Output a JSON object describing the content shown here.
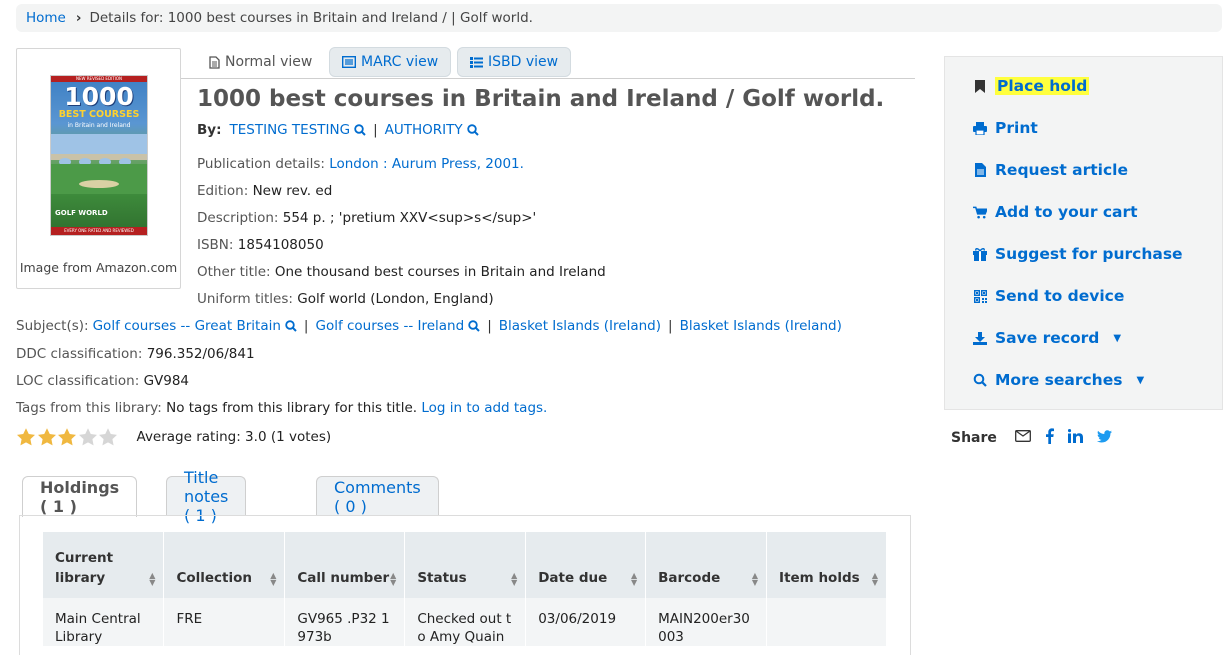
{
  "breadcrumb": {
    "home": "Home",
    "current": "Details for: 1000 best courses in Britain and Ireland / | Golf world."
  },
  "cover": {
    "caption": "Image from Amazon.com",
    "band_text": "NEW REVISED EDITION",
    "big_text": "1000",
    "best_text": "BEST COURSES",
    "sub_text": "in Britain and Ireland",
    "logo_text": "GOLF WORLD",
    "foot_text": "EVERY ONE RATED AND REVIEWED"
  },
  "view_tabs": {
    "normal": "Normal view",
    "marc": "MARC view",
    "isbd": "ISBD view"
  },
  "record": {
    "title": "1000 best courses in Britain and Ireland / Golf world.",
    "by_label": "By:",
    "authors": [
      "TESTING TESTING",
      "AUTHORITY"
    ],
    "pub_label": "Publication details:",
    "pub_value": "London : Aurum Press, 2001.",
    "edition_label": "Edition:",
    "edition_value": "New rev. ed",
    "desc_label": "Description:",
    "desc_value": "554 p. ; 'pretium XXV<sup>s</sup>'",
    "isbn_label": "ISBN:",
    "isbn_value": "1854108050",
    "other_title_label": "Other title:",
    "other_title_value": "One thousand best courses in Britain and Ireland",
    "uniform_label": "Uniform titles:",
    "uniform_value": "Golf world (London, England)",
    "subjects_label": "Subject(s):",
    "subjects": [
      "Golf courses -- Great Britain",
      "Golf courses -- Ireland",
      "Blasket Islands (Ireland)",
      "Blasket Islands (Ireland)"
    ],
    "ddc_label": "DDC classification:",
    "ddc_value": "796.352/06/841",
    "loc_label": "LOC classification:",
    "loc_value": "GV984",
    "tags_label": "Tags from this library:",
    "tags_value": "No tags from this library for this title.",
    "tags_login": "Log in to add tags."
  },
  "rating": {
    "value": 3,
    "max": 5,
    "text": "Average rating: 3.0 (1 votes)",
    "filled_color": "#f0b840",
    "empty_color": "#d6d6d6"
  },
  "holdings_tabs": [
    "Holdings ( 1 )",
    "Title notes ( 1 )",
    "Comments ( 0 )"
  ],
  "holdings": {
    "headers": [
      "Current library",
      "Collection",
      "Call number",
      "Status",
      "Date due",
      "Barcode",
      "Item holds"
    ],
    "rows": [
      [
        "Main Central Library",
        "FRE",
        "GV965 .P32 1973b",
        "Checked out to Amy Quain",
        "03/06/2019",
        "MAIN200er30003",
        ""
      ]
    ]
  },
  "actions": {
    "place_hold": "Place hold",
    "print": "Print",
    "request_article": "Request article",
    "add_cart": "Add to your cart",
    "suggest": "Suggest for purchase",
    "send_device": "Send to device",
    "save_record": "Save record",
    "more_searches": "More searches"
  },
  "share": {
    "label": "Share"
  },
  "colors": {
    "link": "#006ccf",
    "highlight": "#ffff3d",
    "panel": "#f3f4f4"
  }
}
